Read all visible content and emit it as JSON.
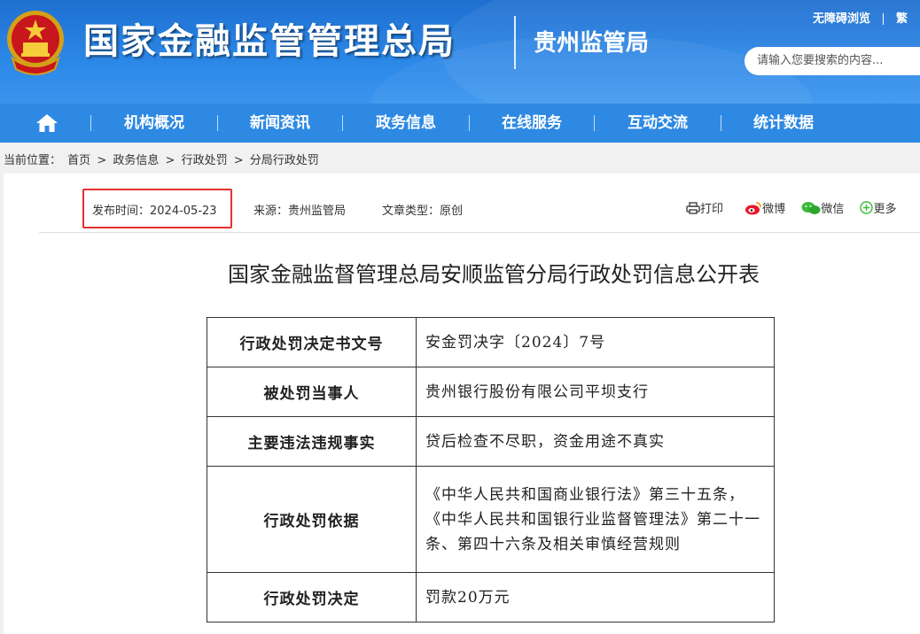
{
  "header": {
    "site_title": "国家金融监管管理总局",
    "sub_title": "贵州监管局",
    "accessibility_link": "无障碍浏览",
    "lang_link": "繁",
    "search_placeholder": "请输入您要搜索的内容..."
  },
  "nav": {
    "home_icon": "home-icon",
    "items": [
      "机构概况",
      "新闻资讯",
      "政务信息",
      "在线服务",
      "互动交流",
      "统计数据"
    ]
  },
  "breadcrumb": {
    "label": "当前位置：",
    "items": [
      "首页",
      "政务信息",
      "行政处罚",
      "分局行政处罚"
    ],
    "separator": ">"
  },
  "article": {
    "publish_time": "发布时间：2024-05-23",
    "source": "来源：贵州监管局",
    "type": "文章类型：原创",
    "share": {
      "print": "打印",
      "weibo": "微博",
      "wechat": "微信",
      "more": "更多"
    },
    "title": "国家金融监督管理总局安顺监管分局行政处罚信息公开表"
  },
  "table": {
    "rows": [
      {
        "key": "行政处罚决定书文号",
        "value": "安金罚决字〔2024〕7号"
      },
      {
        "key": "被处罚当事人",
        "value": "贵州银行股份有限公司平坝支行"
      },
      {
        "key": "主要违法违规事实",
        "value": "贷后检查不尽职，资金用途不真实"
      },
      {
        "key": "行政处罚依据",
        "value": "《中华人民共和国商业银行法》第三十五条，《中华人民共和国银行业监督管理法》第二十一条、第四十六条及相关审慎经营规则"
      },
      {
        "key": "行政处罚决定",
        "value": "罚款20万元"
      }
    ]
  },
  "colors": {
    "header_blue": "#2a86e6",
    "nav_blue": "#2e89e3",
    "highlight_red": "#e8302d"
  }
}
